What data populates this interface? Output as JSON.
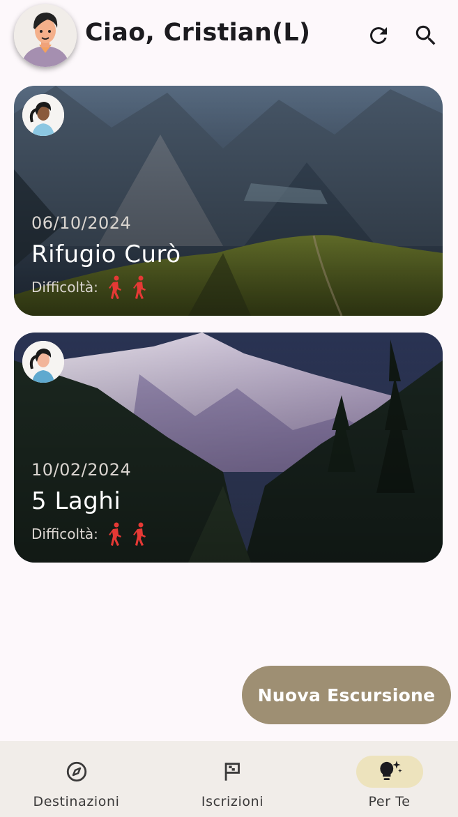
{
  "header": {
    "greeting": "Ciao, Cristian(L)",
    "refresh_icon": "refresh-icon",
    "search_icon": "search-icon"
  },
  "cards": [
    {
      "date": "06/10/2024",
      "title": "Rifugio Curò",
      "difficulty_label": "Difficoltà:",
      "difficulty_level": 2,
      "difficulty_icon": "hiker-icon"
    },
    {
      "date": "10/02/2024",
      "title": "5 Laghi",
      "difficulty_label": "Difficoltà:",
      "difficulty_level": 2,
      "difficulty_icon": "hiker-icon"
    }
  ],
  "fab": {
    "label": "Nuova Escursione"
  },
  "nav": {
    "items": [
      {
        "label": "Destinazioni",
        "icon": "compass-icon",
        "active": false
      },
      {
        "label": "Iscrizioni",
        "icon": "flag-icon",
        "active": false
      },
      {
        "label": "Per Te",
        "icon": "lightbulb-sparkle-icon",
        "active": true
      }
    ]
  },
  "colors": {
    "background": "#fdf8fb",
    "accent": "#9e8f73",
    "nav_background": "#f1ede9",
    "nav_active_pill": "#ede3bd",
    "difficulty_icon": "#e53935"
  }
}
